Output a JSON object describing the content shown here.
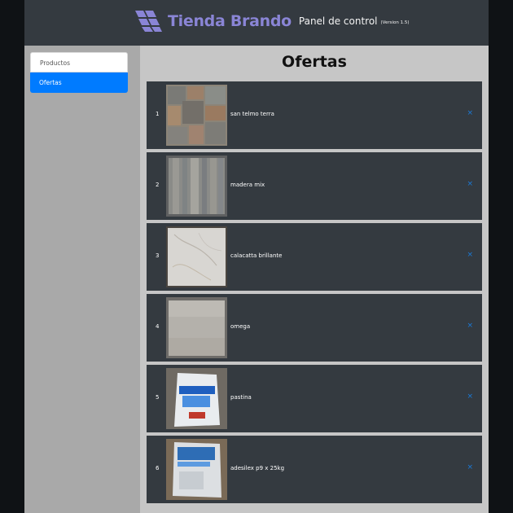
{
  "header": {
    "brand": "Tienda Brando",
    "panel_title": "Panel de control",
    "version": "(Version 1.5)",
    "brand_color": "#8a85d6"
  },
  "sidebar": {
    "items": [
      {
        "label": "Productos",
        "active": false
      },
      {
        "label": "Ofertas",
        "active": true
      }
    ],
    "active_color": "#007bff"
  },
  "main": {
    "title": "Ofertas",
    "items": [
      {
        "index": "1",
        "name": "san telmo terra",
        "image": "stone-tile-icon"
      },
      {
        "index": "2",
        "name": "madera mix",
        "image": "wood-tile-icon"
      },
      {
        "index": "3",
        "name": "calacatta brillante",
        "image": "marble-tile-icon"
      },
      {
        "index": "4",
        "name": "omega",
        "image": "gray-tile-icon"
      },
      {
        "index": "5",
        "name": "pastina",
        "image": "grout-bag-icon"
      },
      {
        "index": "6",
        "name": "adesilex p9 x 25kg",
        "image": "adhesive-bag-icon"
      }
    ],
    "remove_label": "×"
  }
}
